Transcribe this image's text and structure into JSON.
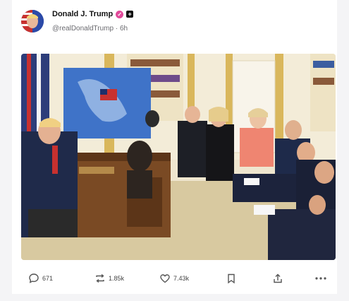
{
  "post": {
    "author_name": "Donald J. Trump",
    "handle": "@realDonaldTrump",
    "separator": "·",
    "timestamp": "6h"
  },
  "actions": {
    "replies": "671",
    "reposts": "1.85k",
    "likes": "7.43k"
  },
  "icons": {
    "verified": "verified-badge-icon",
    "plus": "plus-box-icon",
    "reply": "comment-icon",
    "repost": "repost-icon",
    "like": "heart-icon",
    "bookmark": "bookmark-icon",
    "share": "share-icon",
    "more": "more-icon"
  },
  "colors": {
    "verified_badge": "#e14a9a",
    "background": "#f4f4f6",
    "card": "#ffffff"
  }
}
